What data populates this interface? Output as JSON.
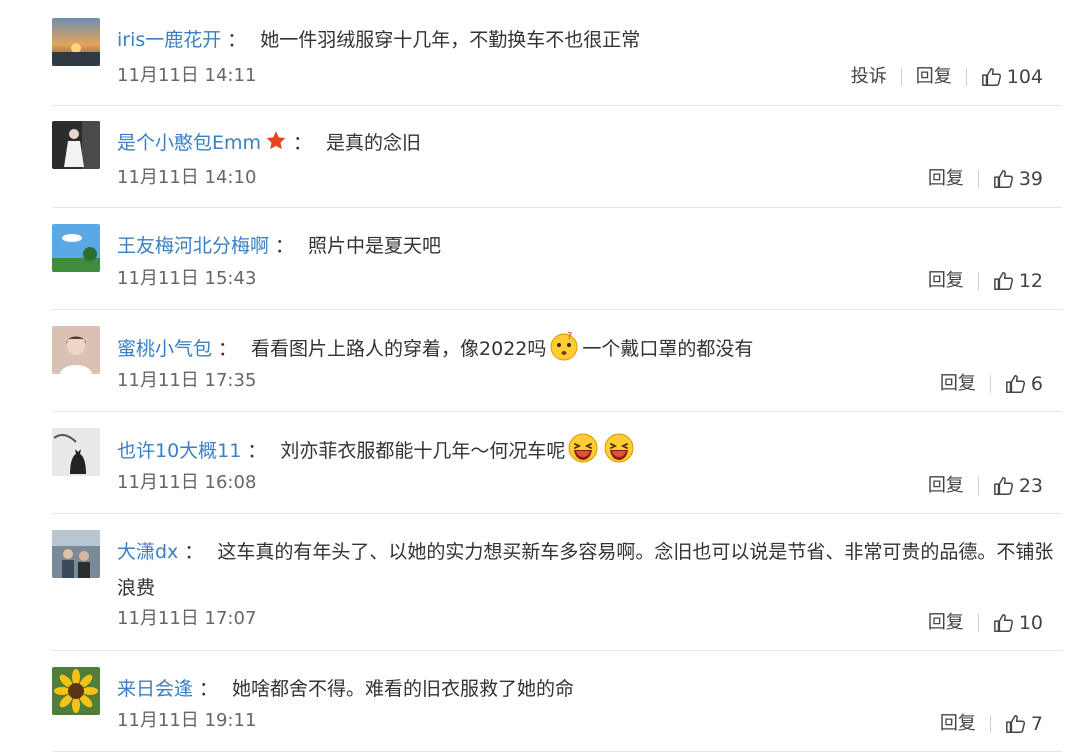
{
  "comments": [
    {
      "user": "iris一鹿花开",
      "sep": "：",
      "content": "她一件羽绒服穿十几年，不勤换车不也很正常",
      "time": "11月11日 14:11",
      "report": "投诉",
      "reply": "回复",
      "likes": "104",
      "avatar_icon": "sunset-avatar",
      "has_report": true
    },
    {
      "user": "是个小憨包Emm",
      "sep": "：",
      "content": "是真的念旧",
      "time": "11月11日 14:10",
      "reply": "回复",
      "likes": "39",
      "avatar_icon": "woman-dress-avatar",
      "badge_icon": "red-star-badge-icon"
    },
    {
      "user": "王友梅河北分梅啊",
      "sep": "：",
      "content": "照片中是夏天吧",
      "time": "11月11日 15:43",
      "reply": "回复",
      "likes": "12",
      "avatar_icon": "sky-landscape-avatar"
    },
    {
      "user": "蜜桃小气包",
      "sep": "：",
      "content_a": "看看图片上路人的穿着，像2022吗",
      "content_b": "一个戴口罩的都没有",
      "time": "11月11日 17:35",
      "reply": "回复",
      "likes": "6",
      "avatar_icon": "woman-portrait-avatar",
      "emoji_icon": "confused-face-emoji"
    },
    {
      "user": "也许10大概11",
      "sep": "：",
      "content": "刘亦菲衣服都能十几年～何况车呢",
      "time": "11月11日 16:08",
      "reply": "回复",
      "likes": "23",
      "avatar_icon": "cat-silhouette-avatar",
      "emoji_icon": "laughing-face-emoji"
    },
    {
      "user": "大潇dx",
      "sep": "：",
      "content": "这车真的有年头了、以她的实力想买新车多容易啊。念旧也可以说是节省、非常可贵的品德。不铺张浪费",
      "time": "11月11日 17:07",
      "reply": "回复",
      "likes": "10",
      "avatar_icon": "people-photo-avatar"
    },
    {
      "user": "来日会逢",
      "sep": "：",
      "content": "她啥都舍不得。难看的旧衣服救了她的命",
      "time": "11月11日 19:11",
      "reply": "回复",
      "likes": "7",
      "avatar_icon": "sunflower-avatar"
    }
  ],
  "colors": {
    "username": "#3a7fc4",
    "text": "#333333",
    "meta": "#666666",
    "divider": "#e6e6e6"
  }
}
